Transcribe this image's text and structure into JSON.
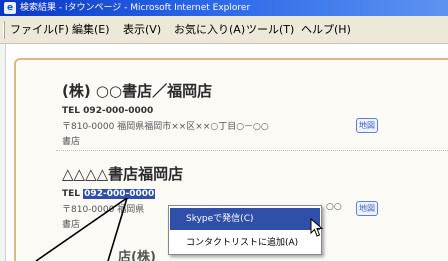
{
  "window": {
    "title": "検索結果 - iタウンページ - Microsoft Internet Explorer"
  },
  "menubar": {
    "items": [
      "ファイル(F)",
      "編集(E)",
      "表示(V)",
      "お気に入り(A)",
      "ツール(T)",
      "ヘルプ(H)"
    ]
  },
  "listings": [
    {
      "name": "(株) ○○書店／福岡店",
      "tel_label": "TEL",
      "tel_number": "092-000-0000",
      "address": "〒810-0000 福岡県福岡市××区××○丁目○－○○",
      "category": "書店",
      "map_label": "地図"
    },
    {
      "name": "△△△△書店福岡店",
      "tel_label": "TEL",
      "tel_number": "092-000-0000",
      "address_visible": "〒810-0000 福岡県",
      "address_tail": "○○",
      "category": "書店",
      "map_label": "地図"
    },
    {
      "name_partial": "店(株)"
    }
  ],
  "context_menu": {
    "items": [
      "Skypeで発信(C)",
      "コンタクトリストに追加(A)"
    ],
    "selected_index": 0
  }
}
